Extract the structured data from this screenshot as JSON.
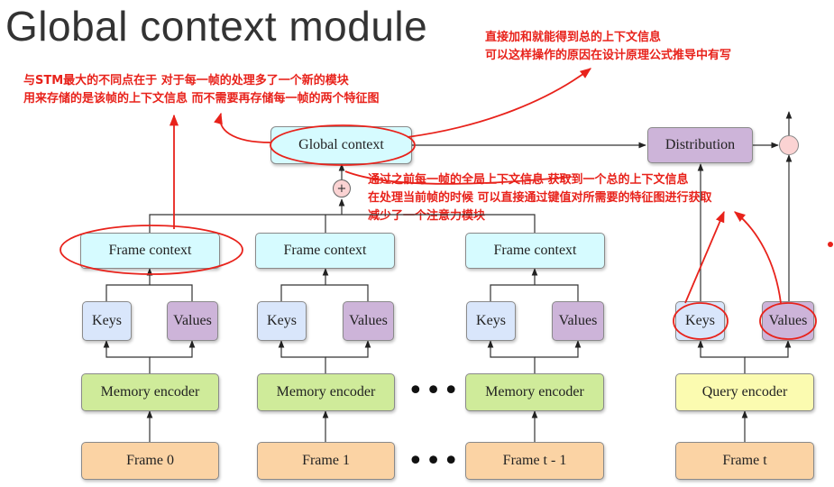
{
  "title": "Global context module",
  "notes": {
    "top_left": [
      "与STM最大的不同点在于  对于每一帧的处理多了一个新的模块",
      "用来存储的是该帧的上下文信息  而不需要再存储每一帧的两个特征图"
    ],
    "top_right": [
      "直接加和就能得到总的上下文信息",
      "可以这样操作的原因在设计原理公式推导中有写"
    ],
    "middle": [
      "通过之前每一帧的全局上下文信息  获取到一个总的上下文信息",
      "在处理当前帧的时候  可以直接通过键值对所需要的特征图进行获取",
      "减少了一个注意力模块"
    ]
  },
  "nodes": {
    "global_context": "Global context",
    "distribution": "Distribution",
    "plus": "+",
    "frame_context": "Frame context",
    "keys": "Keys",
    "values": "Values",
    "memory_encoder": "Memory encoder",
    "query_encoder": "Query encoder",
    "frame_0": "Frame 0",
    "frame_1": "Frame 1",
    "frame_t_minus_1": "Frame t - 1",
    "frame_t": "Frame t",
    "ellipsis": "•••"
  },
  "colors": {
    "annotation": "#e8221b",
    "context": "#d6fbff",
    "keys": "#d9e6fb",
    "values": "#cdb4d9",
    "memory_encoder": "#cfeb9a",
    "query_encoder": "#fbfbb0",
    "frame": "#fbd3a4",
    "multiply_node": "#fbd3d3"
  }
}
